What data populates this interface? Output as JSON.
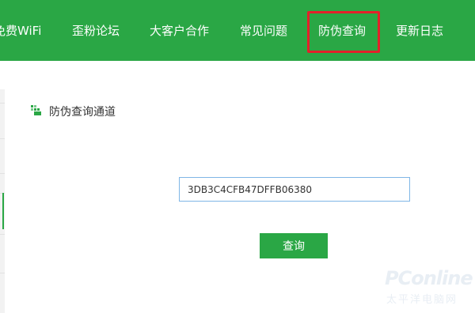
{
  "nav": {
    "items": [
      {
        "label": "免费WiFi"
      },
      {
        "label": "歪粉论坛"
      },
      {
        "label": "大客户合作"
      },
      {
        "label": "常见问题"
      },
      {
        "label": "防伪查询"
      },
      {
        "label": "更新日志"
      }
    ],
    "active_index": 4,
    "highlight_color": "#e3202a"
  },
  "section": {
    "title": "防伪查询通道",
    "icon": "green-block-icon"
  },
  "form": {
    "code_value": "3DB3C4CFB47DFFB06380",
    "submit_label": "查询"
  },
  "watermark": {
    "brand": "PConline",
    "sub": "太平洋电脑网"
  },
  "colors": {
    "accent": "#2aa745",
    "input_border": "#7fb6e6"
  }
}
